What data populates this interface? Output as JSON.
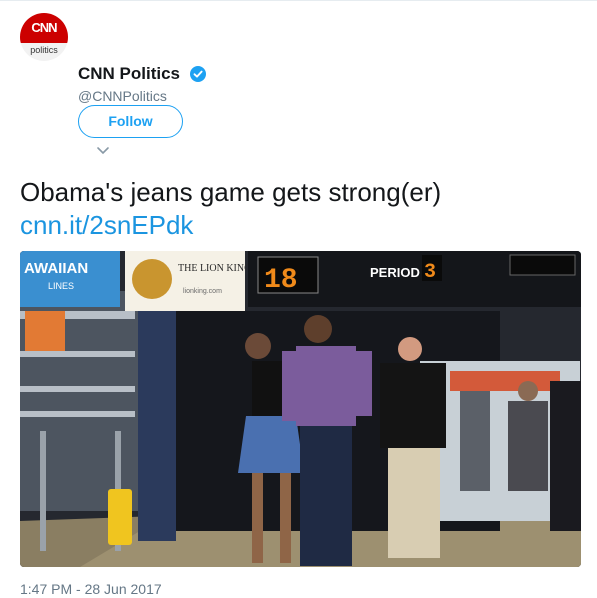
{
  "account": {
    "avatar_logo": "CNN",
    "avatar_sub": "politics",
    "name": "CNN Politics",
    "handle": "@CNNPolitics",
    "verified": true
  },
  "actions": {
    "follow_label": "Follow"
  },
  "tweet": {
    "text": "Obama's jeans game gets strong(er) ",
    "link": "cnn.it/2snEPdk",
    "timestamp": "1:47 PM - 28 Jun 2017"
  },
  "media": {
    "banner_left": "AWAIIAN",
    "banner_left_sub": "LINES",
    "banner_center_title": "THE LION KING",
    "banner_center_sub": "lionking.com",
    "score_home": "18",
    "period_label": "PERIOD",
    "period_value": "3"
  },
  "colors": {
    "accent": "#1da1f2",
    "link": "#1b95e0",
    "brand_red": "#cc0000"
  }
}
